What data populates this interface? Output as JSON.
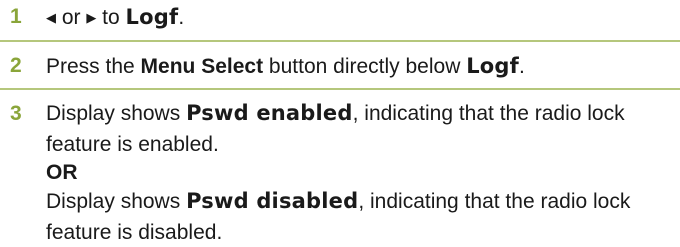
{
  "steps": [
    {
      "number": "1",
      "left_arrow": "◀",
      "or_text": " or ",
      "right_arrow": "▶",
      "to_text": " to ",
      "menu_item": "Logf",
      "end": "."
    },
    {
      "number": "2",
      "pre": "Press the ",
      "button_name": "Menu Select",
      "post": " button directly below ",
      "menu_item": "Logf",
      "end": "."
    },
    {
      "number": "3",
      "line1_pre": "Display shows ",
      "display_enabled": "Pswd enabled",
      "line1_post": ", indicating that the radio lock",
      "line2": "feature is enabled.",
      "or_label": "OR",
      "line4_pre": "Display shows ",
      "display_disabled": "Pswd disabled",
      "line4_post": ", indicating that the radio lock",
      "line5": "feature is disabled."
    }
  ],
  "colors": {
    "step_number": "#8aa53a",
    "divider": "#b5c77c",
    "text": "#1a1a1a"
  }
}
